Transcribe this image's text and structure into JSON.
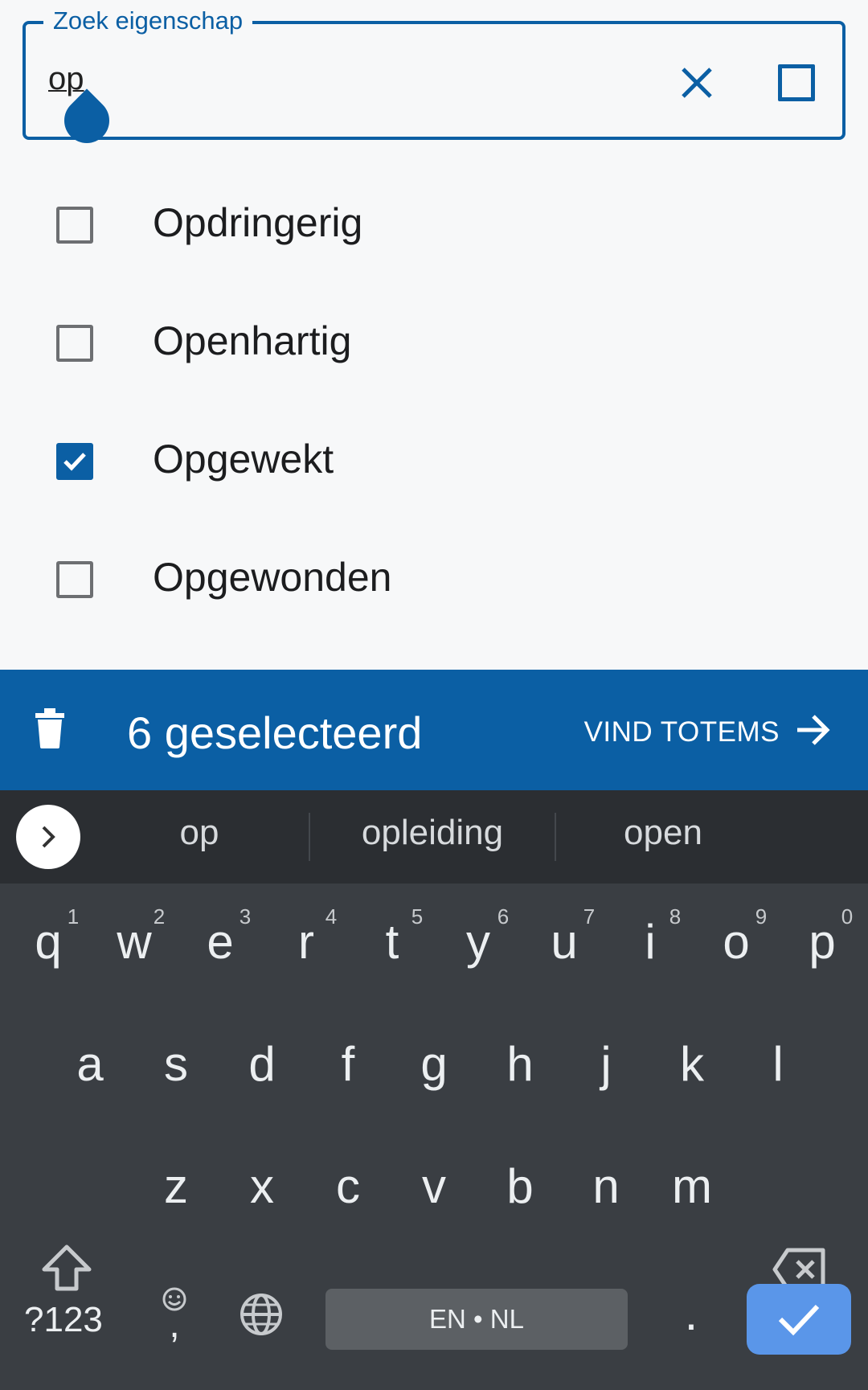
{
  "search": {
    "legend": "Zoek eigenschap",
    "value": "op",
    "clear_icon": "close-icon",
    "select_all_icon": "checkbox-outline-icon"
  },
  "options": [
    {
      "label": "Opdringerig",
      "checked": false
    },
    {
      "label": "Openhartig",
      "checked": false
    },
    {
      "label": "Opgewekt",
      "checked": true
    },
    {
      "label": "Opgewonden",
      "checked": false
    }
  ],
  "action_bar": {
    "selected_count": "6 geselecteerd",
    "find_button": "VIND TOTEMS",
    "delete_icon": "trash-icon",
    "arrow_icon": "arrow-right-icon"
  },
  "keyboard": {
    "suggestions": [
      "op",
      "opleiding",
      "open"
    ],
    "row1": [
      "q",
      "w",
      "e",
      "r",
      "t",
      "y",
      "u",
      "i",
      "o",
      "p"
    ],
    "row1_hints": [
      "1",
      "2",
      "3",
      "4",
      "5",
      "6",
      "7",
      "8",
      "9",
      "0"
    ],
    "row2": [
      "a",
      "s",
      "d",
      "f",
      "g",
      "h",
      "j",
      "k",
      "l"
    ],
    "row3": [
      "z",
      "x",
      "c",
      "v",
      "b",
      "n",
      "m"
    ],
    "symbols": "?123",
    "comma": ",",
    "period": ".",
    "space": "EN • NL"
  },
  "colors": {
    "accent": "#0b5fa4",
    "keyboard_bg": "#3a3e43",
    "enter_key": "#5a96e9"
  }
}
